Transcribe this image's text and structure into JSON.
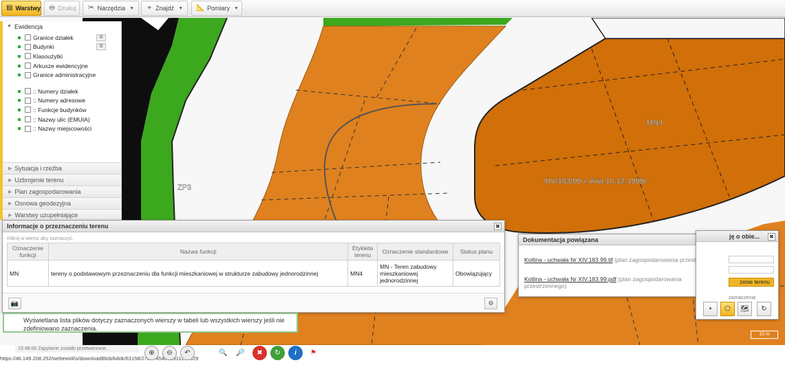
{
  "toolbar": {
    "layers_label": "Warstwy",
    "print_label": "Drukuj",
    "tools_label": "Narzędzia",
    "find_label": "Znajdź",
    "measure_label": "Pomiary"
  },
  "map": {
    "labels": [
      {
        "text": "MN4"
      },
      {
        "text": "XIV/183/99 z dnia 10-12-1999r."
      },
      {
        "text": "ZP3"
      }
    ],
    "colors": {
      "green": "#3ca81e",
      "orange": "#e0811f",
      "brown": "#d16f08",
      "black": "#0e0e0e"
    },
    "scale_label": "10 m"
  },
  "layer_panel": {
    "group_title": "Ewidencja",
    "items": [
      {
        "label": "Granice działek",
        "gear": true
      },
      {
        "label": "Budynki",
        "gear": true
      },
      {
        "label": "Klasoużytki",
        "gear": false
      },
      {
        "label": "Arkusze ewidencyjne",
        "gear": false
      },
      {
        "label": "Granice administracyjne",
        "gear": false
      }
    ],
    "items2": [
      {
        "label": ":: Numery działek"
      },
      {
        "label": ":: Numery adresowe"
      },
      {
        "label": ":: Funkcje budynków"
      },
      {
        "label": ":: Nazwy ulic (EMUIA)"
      },
      {
        "label": ":: Nazwy miejscowości"
      }
    ],
    "collapsed_groups": [
      "Sytuacja i rzeźba",
      "Uzbrojenie terenu",
      "Plan zagospodarowania",
      "Osnowa geodezyjna",
      "Warstwy uzupełniające"
    ]
  },
  "info_dialog": {
    "title": "Informacje o przeznaczeniu terenu",
    "hint": "Kliknij w wiersz aby zaznaczyć.",
    "columns": [
      "Oznaczenie funkcji",
      "Nazwa funkcji",
      "Etykieta terenu",
      "Oznaczenie standardowe",
      "Status planu"
    ],
    "rows": [
      [
        "MN",
        "tereny o podstawowym przeznaczeniu dla funkcji mieszkaniowej w strukturze zabudowy jednorodzinnej",
        "MN4",
        "MN - Teren zabudowy mieszkaniowej jednorodzinnej",
        "Obowiązujący"
      ]
    ]
  },
  "tooltip": {
    "text": "Wyświetlana lista plików dotyczy zaznaczonych wierszy w tabeli lub wszystkich wierszy jeśli nie zdefiniowano zaznaczenia."
  },
  "doc_dialog": {
    "title": "Dokumentacja powiązana",
    "docs": [
      {
        "link": "Kotlina - uchwała Nr XIV.183.99.tif",
        "note": "(plan zagospodarowania przestrzennego)"
      },
      {
        "link": "Kotlina - uchwała Nr XIV.183.99.pdf",
        "note": "(plan zagospodarowania przestrzennego)"
      }
    ]
  },
  "obj_panel": {
    "title": "ję o obie...",
    "button_label": "zenie terenu",
    "label": "zaznaczenia:"
  },
  "status": {
    "message": "15:48:00 Zapytanie zostało przetworzone.",
    "url": "https://46.149.208.252/webewid/is/downloadBlob/kdok/63158/27697454061911278629"
  }
}
